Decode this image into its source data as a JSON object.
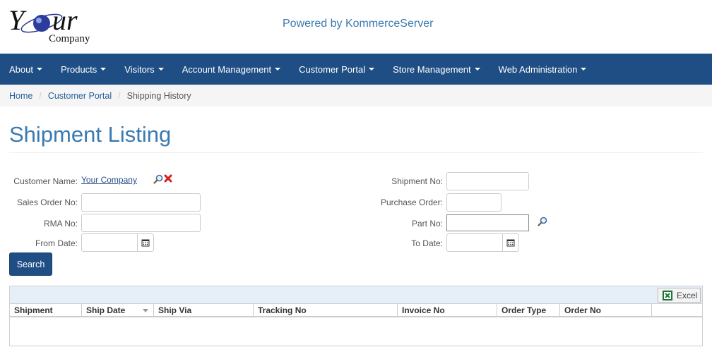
{
  "header": {
    "logo": {
      "wordmark": "Your",
      "sub": "Company"
    },
    "powered_by": "Powered by KommerceServer"
  },
  "nav": {
    "items": [
      {
        "label": "About"
      },
      {
        "label": "Products"
      },
      {
        "label": "Visitors"
      },
      {
        "label": "Account Management"
      },
      {
        "label": "Customer Portal"
      },
      {
        "label": "Store Management"
      },
      {
        "label": "Web Administration"
      }
    ]
  },
  "breadcrumb": {
    "items": [
      "Home",
      "Customer Portal",
      "Shipping History"
    ]
  },
  "page": {
    "title": "Shipment Listing"
  },
  "form": {
    "customer_name": {
      "label": "Customer Name:",
      "value": "Your Company",
      "search_icon": "magnifier-icon",
      "clear_icon": "red-x-icon"
    },
    "sales_order_no": {
      "label": "Sales Order No:",
      "value": ""
    },
    "rma_no": {
      "label": "RMA No:",
      "value": ""
    },
    "from_date": {
      "label": "From Date:",
      "value": ""
    },
    "shipment_no": {
      "label": "Shipment No:",
      "value": ""
    },
    "purchase_order": {
      "label": "Purchase Order:",
      "value": ""
    },
    "part_no": {
      "label": "Part No:",
      "value": ""
    },
    "to_date": {
      "label": "To Date:",
      "value": ""
    },
    "search_label": "Search"
  },
  "grid": {
    "export_label": "Excel",
    "columns": [
      "Shipment",
      "Ship Date",
      "Ship Via",
      "Tracking No",
      "Invoice No",
      "Order Type",
      "Order No"
    ],
    "rows": []
  },
  "colors": {
    "navbar": "#1f4e85",
    "title": "#3a7ab0",
    "link": "#2a5f96",
    "breadcrumb_bg": "#f5f5f5",
    "grid_toolbar": "#e6eef8"
  }
}
